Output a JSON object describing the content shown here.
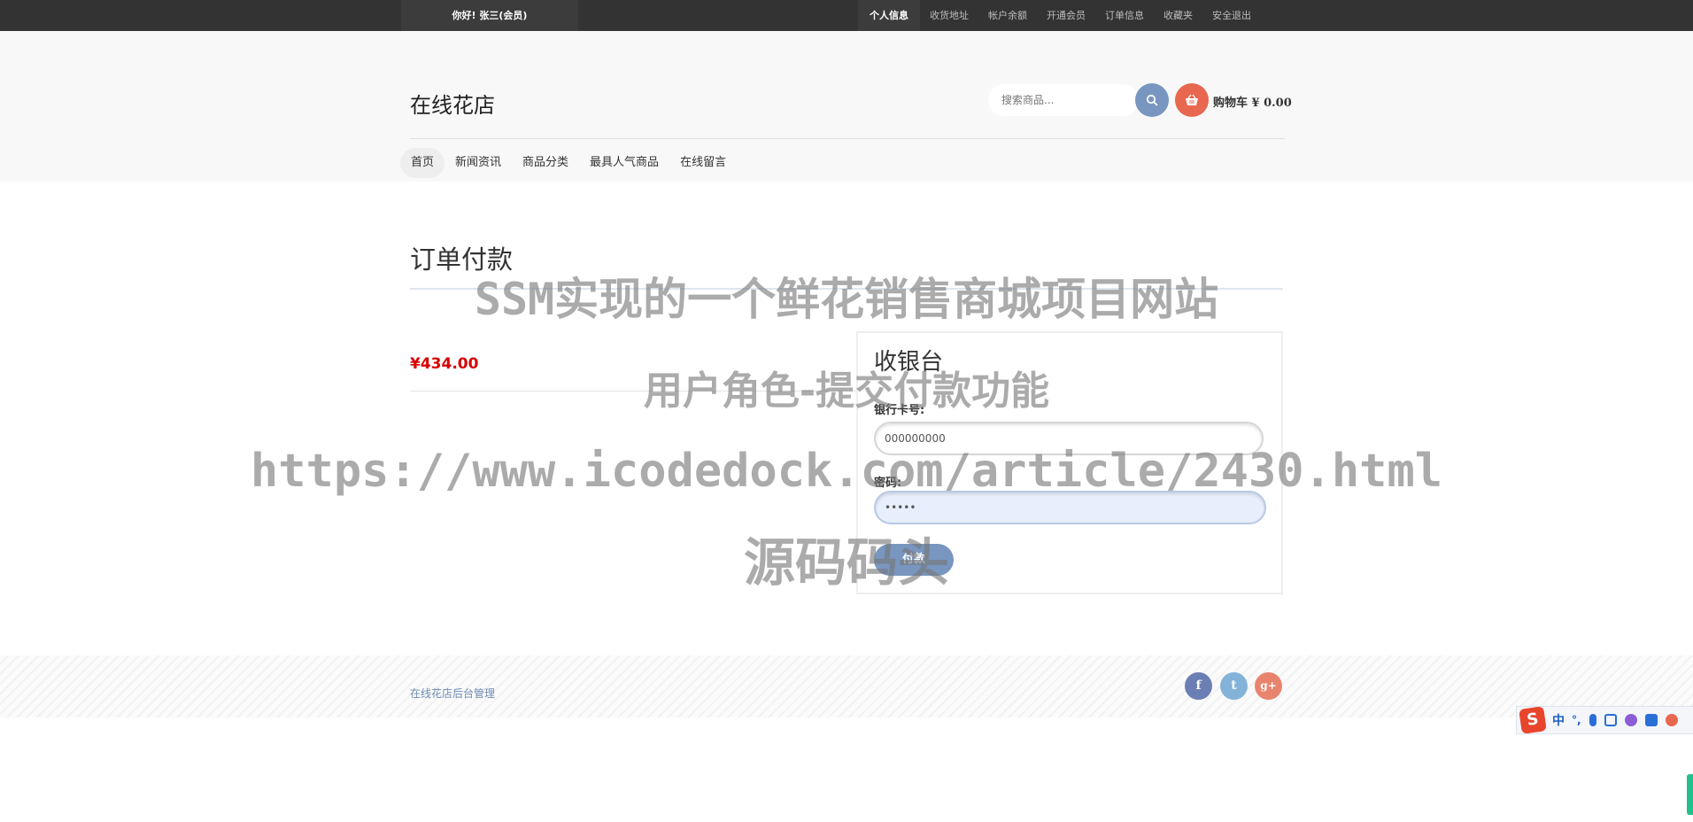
{
  "topbar": {
    "greeting": "你好!  张三(会员)",
    "nav": [
      {
        "label": "个人信息",
        "active": true
      },
      {
        "label": "收货地址",
        "active": false
      },
      {
        "label": "帐户余额",
        "active": false
      },
      {
        "label": "开通会员",
        "active": false
      },
      {
        "label": "订单信息",
        "active": false
      },
      {
        "label": "收藏夹",
        "active": false
      },
      {
        "label": "安全退出",
        "active": false
      }
    ]
  },
  "header": {
    "logo": "在线花店",
    "search_placeholder": "搜索商品...",
    "search_icon": "search-icon",
    "cart_icon": "basket-icon",
    "cart_label": "购物车 ¥ 0.00",
    "nav": [
      {
        "label": "首页",
        "active": true
      },
      {
        "label": "新闻资讯",
        "active": false
      },
      {
        "label": "商品分类",
        "active": false
      },
      {
        "label": "最具人气商品",
        "active": false
      },
      {
        "label": "在线留言",
        "active": false
      }
    ]
  },
  "main": {
    "title": "订单付款",
    "price": "¥434.00",
    "checkout": {
      "title": "收银台",
      "card_label": "银行卡号:",
      "card_value": "000000000",
      "password_label": "密码:",
      "password_value": "•••••",
      "submit_label": "付款"
    }
  },
  "footer": {
    "admin_link": "在线花店后台管理",
    "social": [
      {
        "icon": "facebook-icon",
        "glyph": "f",
        "color": "#6b7fb4"
      },
      {
        "icon": "twitter-icon",
        "glyph": "t",
        "color": "#84b3da"
      },
      {
        "icon": "google-plus-icon",
        "glyph": "g+",
        "color": "#e8846d"
      }
    ]
  },
  "watermark": {
    "line1": "SSM实现的一个鲜花销售商城项目网站",
    "line2": "用户角色-提交付款功能",
    "line3": "https://www.icodedock.com/article/2430.html",
    "line4": "源码码头"
  },
  "ime": {
    "logo": "S",
    "lang": "中",
    "punct": "°,"
  },
  "colors": {
    "topbar": "#333333",
    "accent_blue": "#7896bf",
    "accent_orange": "#e8674f",
    "price_red": "#d70000"
  }
}
